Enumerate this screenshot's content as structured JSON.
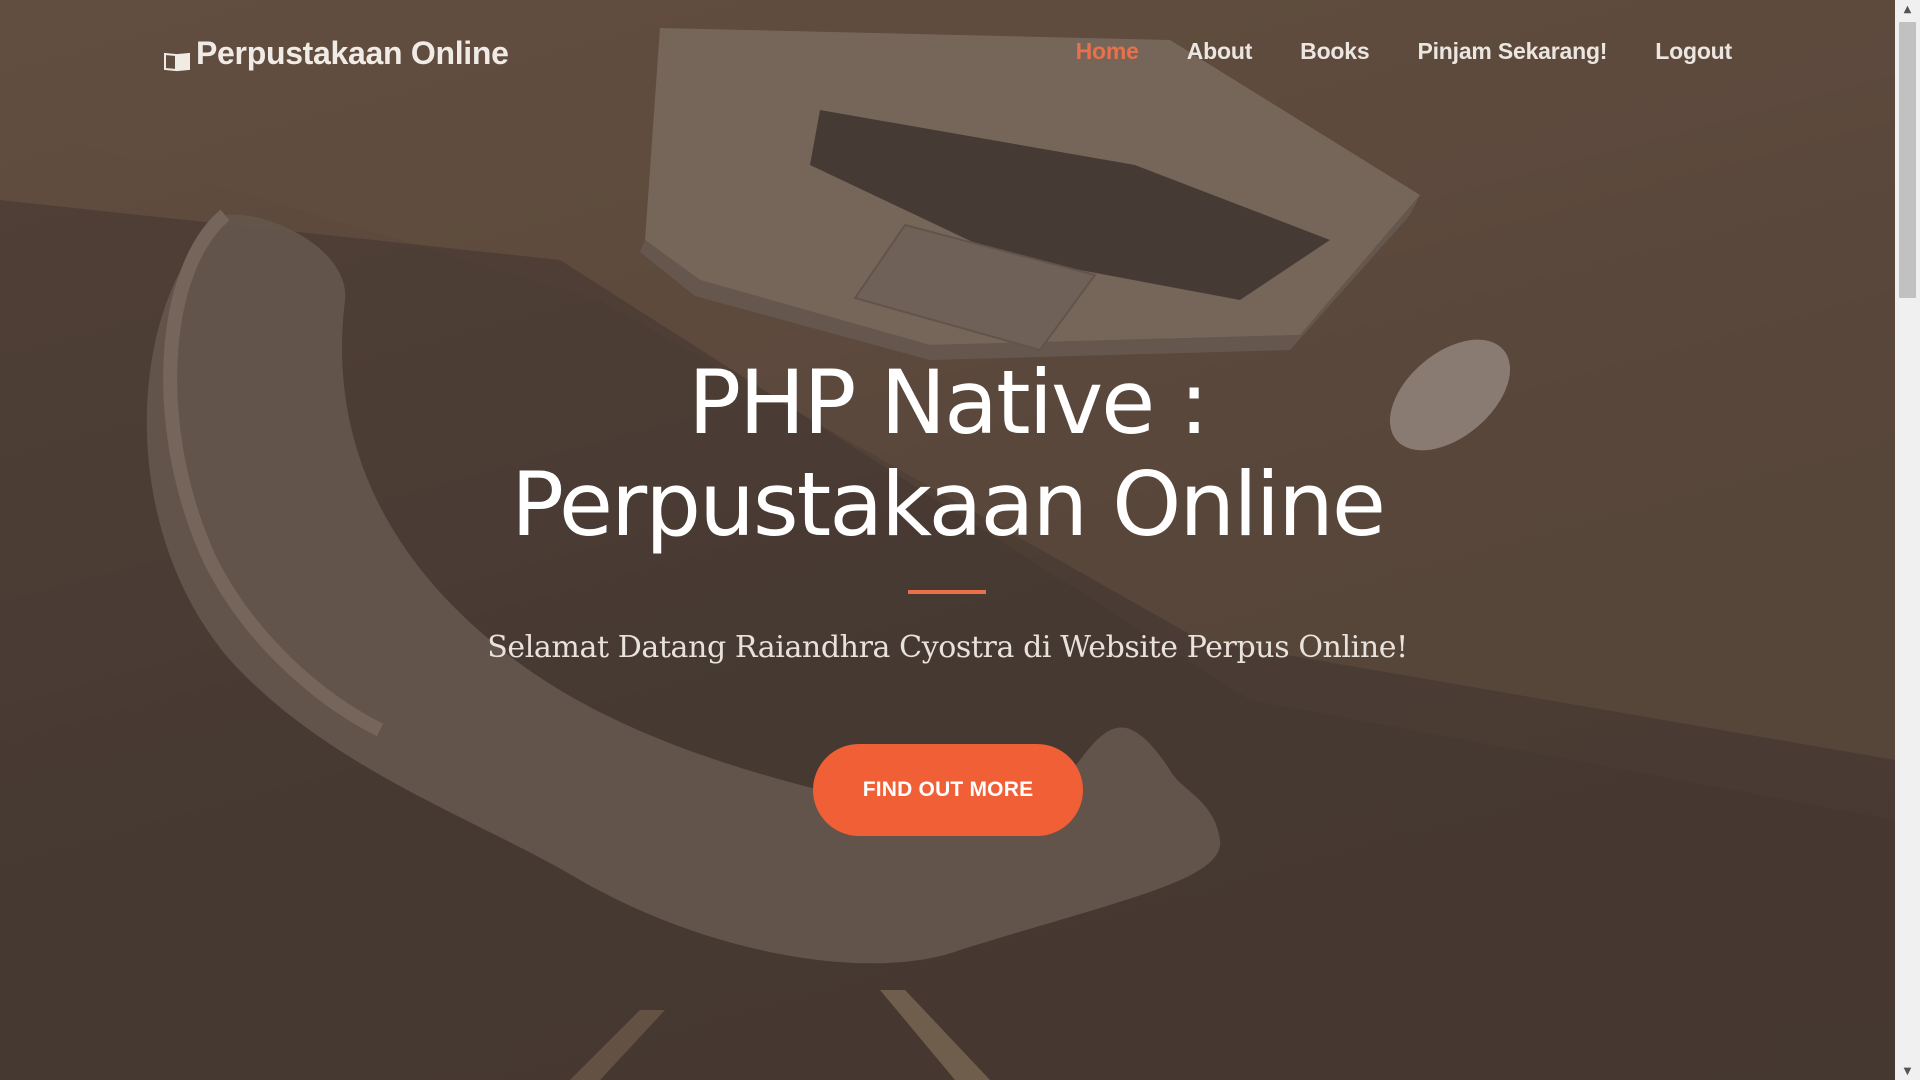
{
  "navbar": {
    "brand": "Perpustakaan Online",
    "links": [
      {
        "label": "Home",
        "active": true
      },
      {
        "label": "About",
        "active": false
      },
      {
        "label": "Books",
        "active": false
      },
      {
        "label": "Pinjam Sekarang!",
        "active": false
      },
      {
        "label": "Logout",
        "active": false
      }
    ]
  },
  "hero": {
    "title_line1": "PHP Native :",
    "title_line2": "Perpustakaan Online",
    "subtitle": "Selamat Datang Raiandhra Cyostra di Website Perpus Online!",
    "cta_label": "FIND OUT MORE"
  },
  "colors": {
    "accent": "#e8704b",
    "button": "#f05f35",
    "text": "#ffffff"
  },
  "icons": {
    "brand": "book-open-icon",
    "scroll_up": "arrow-up-icon",
    "scroll_down": "arrow-down-icon"
  }
}
